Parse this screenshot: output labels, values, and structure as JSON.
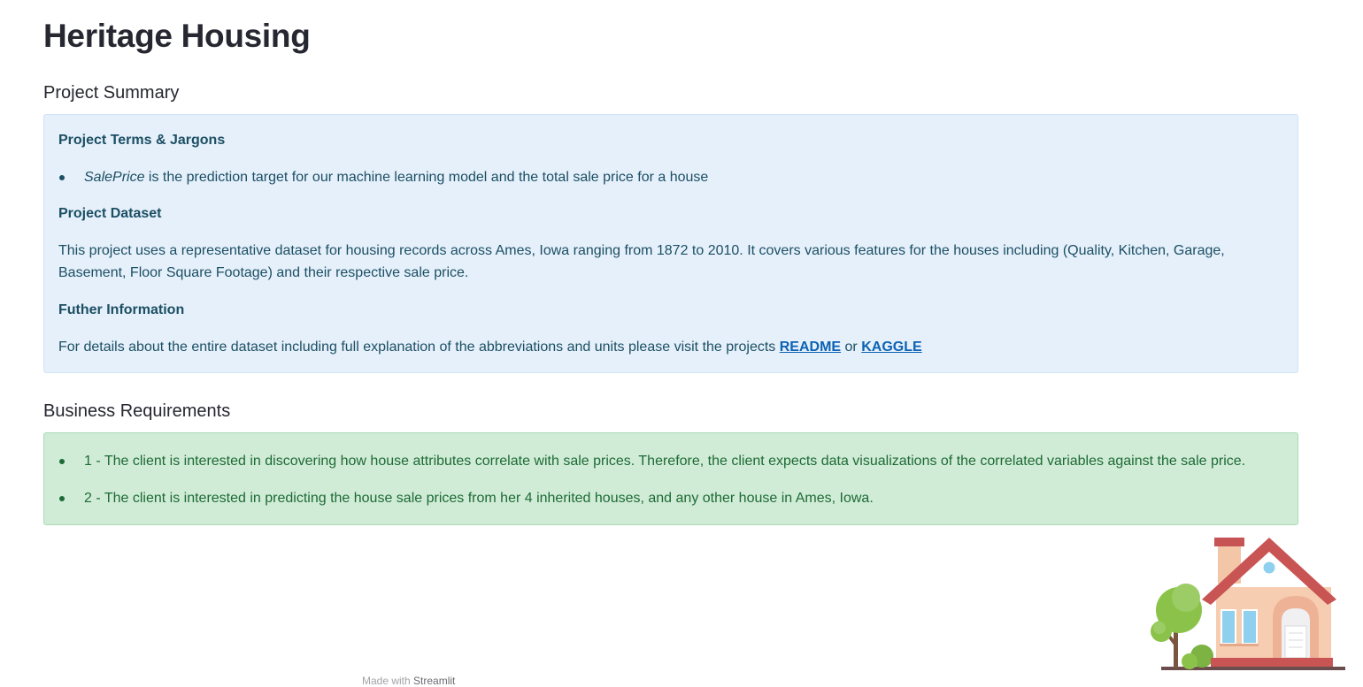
{
  "page": {
    "title": "Heritage Housing"
  },
  "project_summary": {
    "heading": "Project Summary",
    "terms_heading": "Project Terms & Jargons",
    "terms_items": [
      {
        "term": "SalePrice",
        "description": " is the prediction target for our machine learning model and the total sale price for a house"
      }
    ],
    "dataset_heading": "Project Dataset",
    "dataset_text": "This project uses a representative dataset for housing records across Ames, Iowa ranging from 1872 to 2010. It covers various features for the houses including (Quality, Kitchen, Garage, Basement, Floor Square Footage) and their respective sale price.",
    "further_heading": "Futher Information",
    "further_text": "For details about the entire dataset including full explanation of the abbreviations and units please visit the projects ",
    "readme_label": "README",
    "or_text": " or ",
    "kaggle_label": "KAGGLE"
  },
  "business_requirements": {
    "heading": "Business Requirements",
    "items": [
      "1 - The client is interested in discovering how house attributes correlate with sale prices. Therefore, the client expects data visualizations of the correlated variables against the sale price.",
      "2 - The client is interested in predicting the house sale prices from her 4 inherited houses, and any other house in Ames, Iowa."
    ]
  },
  "footer": {
    "made_with": "Made with ",
    "brand": "Streamlit"
  },
  "icons": {
    "house_illustration": "house-with-tree-illustration"
  },
  "colors": {
    "info_bg": "#e5f0fb",
    "info_text": "#1c4f63",
    "success_bg": "#d0ecd6",
    "success_text": "#1e6a36",
    "link": "#0c62b3"
  }
}
